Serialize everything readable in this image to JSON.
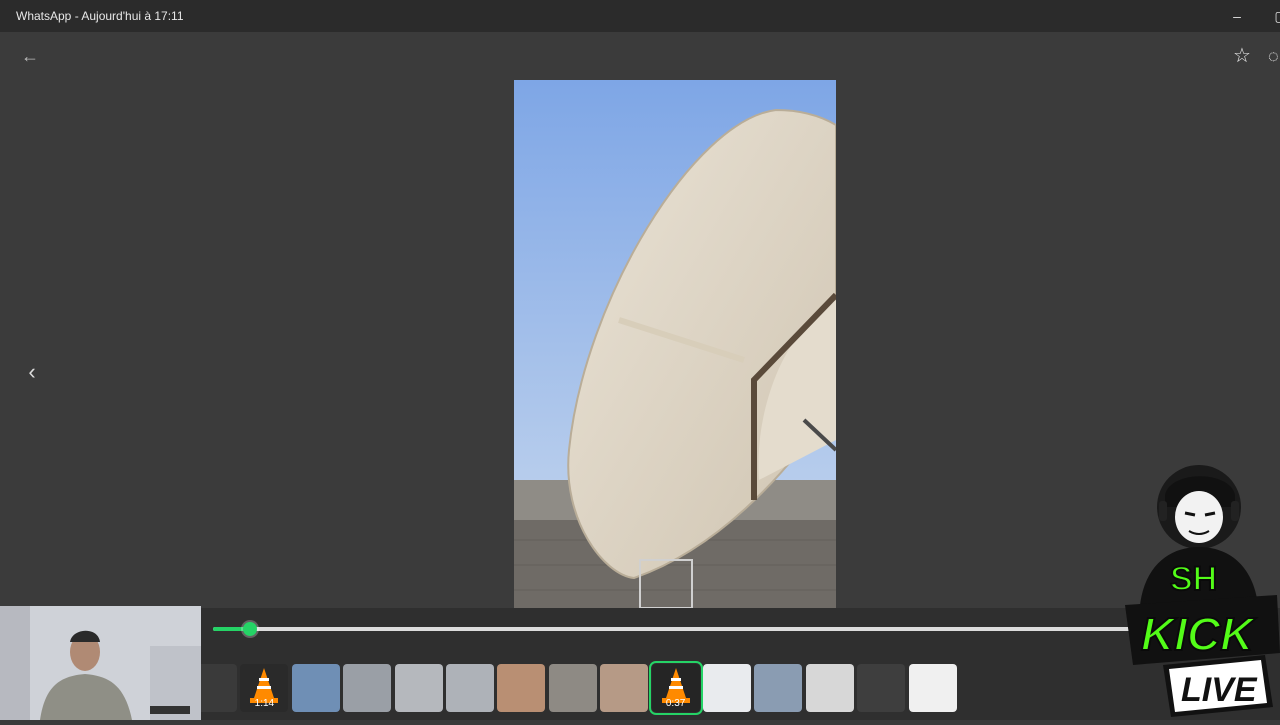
{
  "window": {
    "title": "WhatsApp - Aujourd'hui à 17:11",
    "minimize_icon": "minimize-icon",
    "maximize_icon": "maximize-icon"
  },
  "viewer": {
    "back_icon": "arrow-left-icon",
    "star_icon": "star-icon",
    "more_icon": "more-icon",
    "prev_icon": "chevron-left-icon",
    "media_name": "satellite-dish-video-frame"
  },
  "player": {
    "progress": 0.04,
    "accent": "#25d366"
  },
  "thumbnails": [
    {
      "kind": "image",
      "label": ""
    },
    {
      "kind": "vlc-video",
      "label": "1:14"
    },
    {
      "kind": "image",
      "label": ""
    },
    {
      "kind": "image",
      "label": ""
    },
    {
      "kind": "image",
      "label": ""
    },
    {
      "kind": "image",
      "label": ""
    },
    {
      "kind": "image",
      "label": ""
    },
    {
      "kind": "image",
      "label": ""
    },
    {
      "kind": "image",
      "label": ""
    },
    {
      "kind": "vlc-video",
      "label": "0:37",
      "active": true
    },
    {
      "kind": "screenshot",
      "label": ""
    },
    {
      "kind": "image",
      "label": ""
    },
    {
      "kind": "image",
      "label": ""
    },
    {
      "kind": "screenshot",
      "label": ""
    },
    {
      "kind": "screenshot",
      "label": ""
    }
  ],
  "stream_overlay": {
    "line1": "SH",
    "line2": "KICK",
    "line3": "LIVE",
    "brand_color": "#53fc18"
  }
}
